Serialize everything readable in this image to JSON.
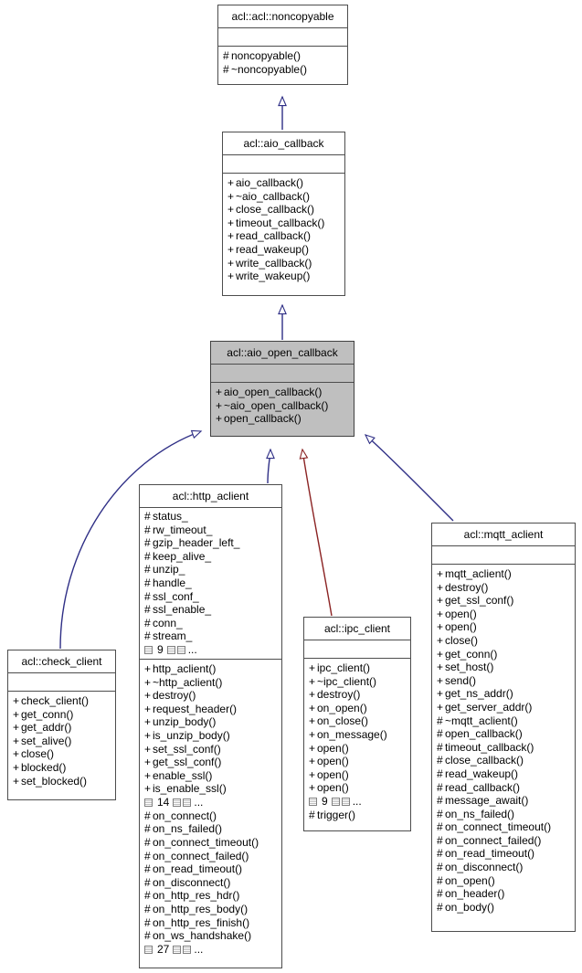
{
  "diagram": {
    "kind": "uml-inheritance-diagram",
    "focus_class": "acl::aio_open_callback",
    "colors": {
      "inherit_arrow": "#2f2f86",
      "protected_arrow": "#8b2323",
      "highlight_fill": "#bfbfbf",
      "box_border": "#4d4d4d",
      "background": "#ffffff"
    }
  },
  "classes": {
    "noncopyable": {
      "name": "acl::acl::noncopyable",
      "attributes": [],
      "operations": [
        {
          "vis": "#",
          "label": "noncopyable()"
        },
        {
          "vis": "#",
          "label": "~noncopyable()"
        }
      ],
      "more_attributes": null,
      "more_operations": null
    },
    "aio_callback": {
      "name": "acl::aio_callback",
      "attributes": [],
      "operations": [
        {
          "vis": "+",
          "label": "aio_callback()"
        },
        {
          "vis": "+",
          "label": "~aio_callback()"
        },
        {
          "vis": "+",
          "label": "close_callback()"
        },
        {
          "vis": "+",
          "label": "timeout_callback()"
        },
        {
          "vis": "+",
          "label": "read_callback()"
        },
        {
          "vis": "+",
          "label": "read_wakeup()"
        },
        {
          "vis": "+",
          "label": "write_callback()"
        },
        {
          "vis": "+",
          "label": "write_wakeup()"
        }
      ],
      "more_attributes": null,
      "more_operations": null
    },
    "aio_open_callback": {
      "name": "acl::aio_open_callback",
      "attributes": [],
      "operations": [
        {
          "vis": "+",
          "label": "aio_open_callback()"
        },
        {
          "vis": "+",
          "label": "~aio_open_callback()"
        },
        {
          "vis": "+",
          "label": "open_callback()"
        }
      ],
      "more_attributes": null,
      "more_operations": null,
      "highlighted": true
    },
    "check_client": {
      "name": "acl::check_client",
      "attributes": [],
      "operations": [
        {
          "vis": "+",
          "label": "check_client()"
        },
        {
          "vis": "+",
          "label": "get_conn()"
        },
        {
          "vis": "+",
          "label": "get_addr()"
        },
        {
          "vis": "+",
          "label": "set_alive()"
        },
        {
          "vis": "+",
          "label": "close()"
        },
        {
          "vis": "+",
          "label": "blocked()"
        },
        {
          "vis": "+",
          "label": "set_blocked()"
        }
      ],
      "more_attributes": null,
      "more_operations": null
    },
    "http_aclient": {
      "name": "acl::http_aclient",
      "attributes": [
        {
          "vis": "#",
          "label": "status_"
        },
        {
          "vis": "#",
          "label": "rw_timeout_"
        },
        {
          "vis": "#",
          "label": "gzip_header_left_"
        },
        {
          "vis": "#",
          "label": "keep_alive_"
        },
        {
          "vis": "#",
          "label": "unzip_"
        },
        {
          "vis": "#",
          "label": "handle_"
        },
        {
          "vis": "#",
          "label": "ssl_conf_"
        },
        {
          "vis": "#",
          "label": "ssl_enable_"
        },
        {
          "vis": "#",
          "label": "conn_"
        },
        {
          "vis": "#",
          "label": "stream_"
        }
      ],
      "more_attributes": "9",
      "operations": [
        {
          "vis": "+",
          "label": "http_aclient()"
        },
        {
          "vis": "+",
          "label": "~http_aclient()"
        },
        {
          "vis": "+",
          "label": "destroy()"
        },
        {
          "vis": "+",
          "label": "request_header()"
        },
        {
          "vis": "+",
          "label": "unzip_body()"
        },
        {
          "vis": "+",
          "label": "is_unzip_body()"
        },
        {
          "vis": "+",
          "label": "set_ssl_conf()"
        },
        {
          "vis": "+",
          "label": "get_ssl_conf()"
        },
        {
          "vis": "+",
          "label": "enable_ssl()"
        },
        {
          "vis": "+",
          "label": "is_enable_ssl()"
        }
      ],
      "more_operations": "14",
      "operations2": [
        {
          "vis": "#",
          "label": "on_connect()"
        },
        {
          "vis": "#",
          "label": "on_ns_failed()"
        },
        {
          "vis": "#",
          "label": "on_connect_timeout()"
        },
        {
          "vis": "#",
          "label": "on_connect_failed()"
        },
        {
          "vis": "#",
          "label": "on_read_timeout()"
        },
        {
          "vis": "#",
          "label": "on_disconnect()"
        },
        {
          "vis": "#",
          "label": "on_http_res_hdr()"
        },
        {
          "vis": "#",
          "label": "on_http_res_body()"
        },
        {
          "vis": "#",
          "label": "on_http_res_finish()"
        },
        {
          "vis": "#",
          "label": "on_ws_handshake()"
        }
      ],
      "more_operations2": "27"
    },
    "ipc_client": {
      "name": "acl::ipc_client",
      "attributes": [],
      "operations": [
        {
          "vis": "+",
          "label": "ipc_client()"
        },
        {
          "vis": "+",
          "label": "~ipc_client()"
        },
        {
          "vis": "+",
          "label": "destroy()"
        },
        {
          "vis": "+",
          "label": "on_open()"
        },
        {
          "vis": "+",
          "label": "on_close()"
        },
        {
          "vis": "+",
          "label": "on_message()"
        },
        {
          "vis": "+",
          "label": "open()"
        },
        {
          "vis": "+",
          "label": "open()"
        },
        {
          "vis": "+",
          "label": "open()"
        },
        {
          "vis": "+",
          "label": "open()"
        }
      ],
      "more_operations": "9",
      "operations2": [
        {
          "vis": "#",
          "label": "trigger()"
        }
      ],
      "more_operations2": null
    },
    "mqtt_aclient": {
      "name": "acl::mqtt_aclient",
      "attributes": [],
      "operations": [
        {
          "vis": "+",
          "label": "mqtt_aclient()"
        },
        {
          "vis": "+",
          "label": "destroy()"
        },
        {
          "vis": "+",
          "label": "get_ssl_conf()"
        },
        {
          "vis": "+",
          "label": "open()"
        },
        {
          "vis": "+",
          "label": "open()"
        },
        {
          "vis": "+",
          "label": "close()"
        },
        {
          "vis": "+",
          "label": "get_conn()"
        },
        {
          "vis": "+",
          "label": "set_host()"
        },
        {
          "vis": "+",
          "label": "send()"
        },
        {
          "vis": "+",
          "label": "get_ns_addr()"
        },
        {
          "vis": "+",
          "label": "get_server_addr()"
        },
        {
          "vis": "#",
          "label": "~mqtt_aclient()"
        },
        {
          "vis": "#",
          "label": "open_callback()"
        },
        {
          "vis": "#",
          "label": "timeout_callback()"
        },
        {
          "vis": "#",
          "label": "close_callback()"
        },
        {
          "vis": "#",
          "label": "read_wakeup()"
        },
        {
          "vis": "#",
          "label": "read_callback()"
        },
        {
          "vis": "#",
          "label": "message_await()"
        },
        {
          "vis": "#",
          "label": "on_ns_failed()"
        },
        {
          "vis": "#",
          "label": "on_connect_timeout()"
        },
        {
          "vis": "#",
          "label": "on_connect_failed()"
        },
        {
          "vis": "#",
          "label": "on_read_timeout()"
        },
        {
          "vis": "#",
          "label": "on_disconnect()"
        },
        {
          "vis": "#",
          "label": "on_open()"
        },
        {
          "vis": "#",
          "label": "on_header()"
        },
        {
          "vis": "#",
          "label": "on_body()"
        }
      ],
      "more_attributes": null,
      "more_operations": null
    }
  },
  "edges": [
    {
      "from": "aio_callback",
      "to": "noncopyable",
      "type": "public-inheritance"
    },
    {
      "from": "aio_open_callback",
      "to": "aio_callback",
      "type": "public-inheritance"
    },
    {
      "from": "check_client",
      "to": "aio_open_callback",
      "type": "public-inheritance"
    },
    {
      "from": "http_aclient",
      "to": "aio_open_callback",
      "type": "public-inheritance"
    },
    {
      "from": "ipc_client",
      "to": "aio_open_callback",
      "type": "protected-inheritance"
    },
    {
      "from": "mqtt_aclient",
      "to": "aio_open_callback",
      "type": "public-inheritance"
    }
  ],
  "labels": {
    "more_suffix": "..."
  }
}
